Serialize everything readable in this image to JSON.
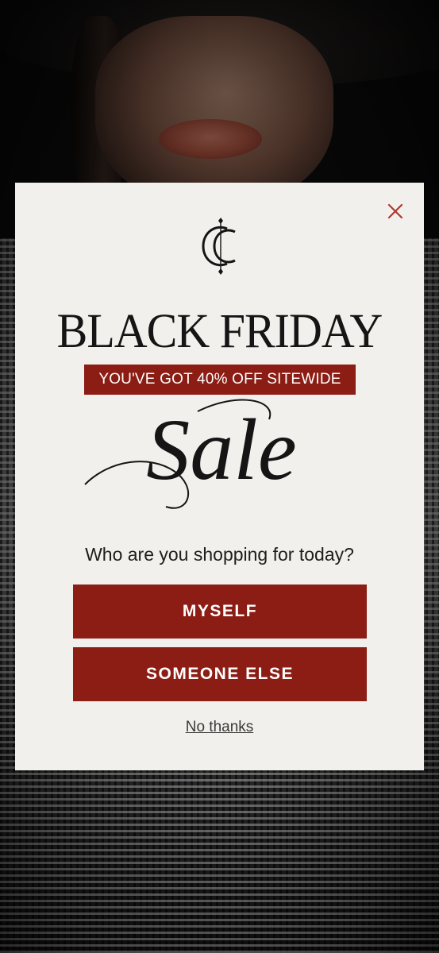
{
  "popup": {
    "headline": "BLACK FRIDAY",
    "badge": "YOU'VE GOT 40% OFF SITEWIDE",
    "script_word": "Sale",
    "question": "Who are you shopping for today?",
    "buttons": [
      {
        "label": "MYSELF"
      },
      {
        "label": "SOMEONE ELSE"
      }
    ],
    "dismiss_link": "No thanks",
    "close_icon": "close-icon",
    "logo_icon": "cc-monogram-logo"
  },
  "colors": {
    "accent": "#8c1d14",
    "modal_bg": "#f1f0ed",
    "text": "#161414",
    "close": "#b0382c"
  }
}
